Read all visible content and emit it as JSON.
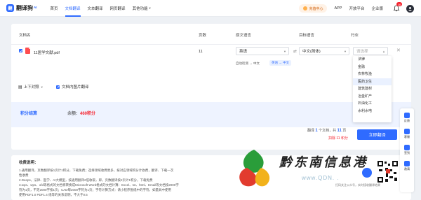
{
  "brand": {
    "name": "翻译狗",
    "ai": "AI",
    "mark": "翻"
  },
  "nav": [
    {
      "label": "首页"
    },
    {
      "label": "文档翻译"
    },
    {
      "label": "文本翻译"
    },
    {
      "label": "网页翻译"
    },
    {
      "label": "其他功能"
    }
  ],
  "top_right": {
    "recharge": "充值中心",
    "app": "APP",
    "dev": "开放平台",
    "enterprise": "企业版",
    "bell_badge": "16"
  },
  "table": {
    "headers": {
      "name": "文档名",
      "pages": "页数",
      "source": "原文语言",
      "target": "目标语言",
      "industry": "行业"
    },
    "row": {
      "file_name": "11医学文献.pdf",
      "pages": "11",
      "source_lang": "英语",
      "target_lang": "中文(简体)",
      "industry_placeholder": "请选择",
      "auto_detect": "自动检测 → 中文",
      "lang_tag": "英语 → 中文"
    }
  },
  "industry_options": [
    "法律",
    "金融",
    "农林牧渔",
    "医药卫生",
    "建筑建材",
    "冶金矿产",
    "石油化工",
    "水利水电"
  ],
  "options": {
    "layout": "上下对照",
    "image_translate": "文档内图片翻译"
  },
  "calc": {
    "title": "积分结算",
    "balance_label": "余额：",
    "balance": "460积分"
  },
  "footer": {
    "info_pre": "翻译",
    "doc_count": "1",
    "info_mid": "个文档，共",
    "page_count": "11",
    "info_post": "页",
    "cost": "扣除 11 积分",
    "button": "立即翻译"
  },
  "notes": {
    "title": "收费说明：",
    "lines": [
      "1.通用翻译，页数翻译按1页计1积分，下载免费；选择领域收费更多，按对应领域积分计收费，翻译、下载一次",
      "性收费",
      "2.Deeps，法律、医学、AI大模型，按通用翻译2倍收取，即，页数翻译按2页计1积分，下载免费",
      "3.wps、wps、ofd等格式的文档将转换成Microsoft Word格式的文档计算：Excel、txt、html、Email等文档按2000字",
      "符为1页，不足2000字按1页；CAD每2000字符为1页；字符计算方式：请小程序图纸中的字符，如量具中使用",
      "使用PDF1.0 PDF1.4   纸等的关系说明，不大于0.5"
    ]
  },
  "side_tools": [
    "反馈",
    "客服",
    "签到",
    "邀请"
  ],
  "qr_tip": "扫码关注公众号，实时接收翻译结果",
  "watermark": {
    "text": "黔东南信息港",
    "url": "www.QDN.   ."
  }
}
